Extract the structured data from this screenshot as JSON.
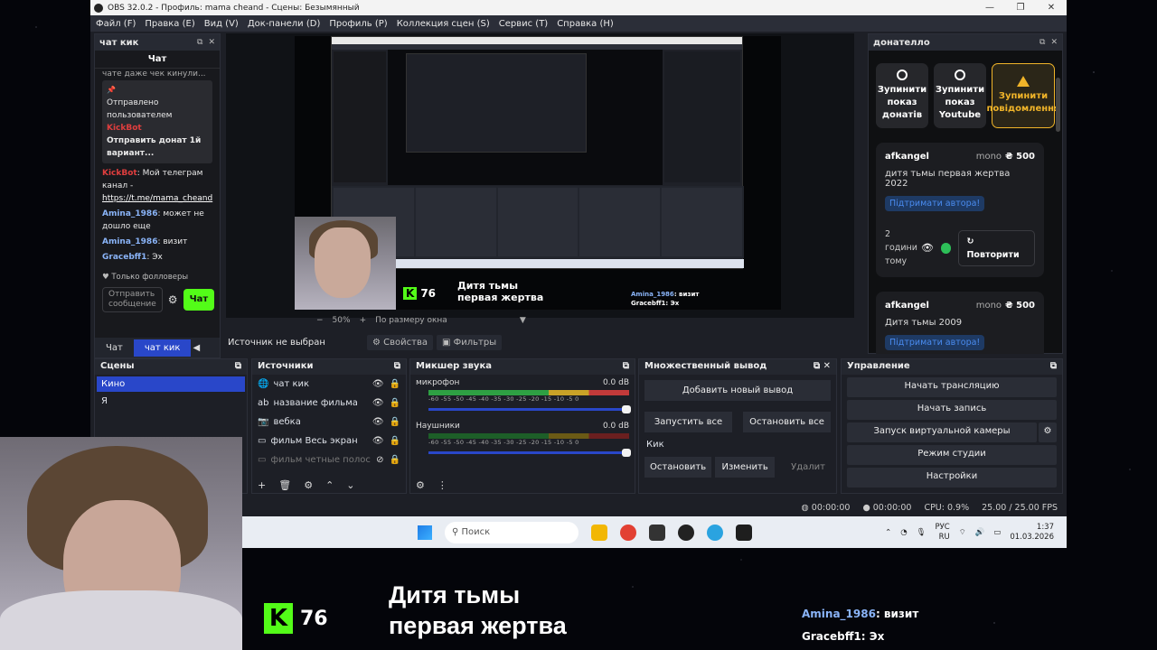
{
  "window": {
    "title": "OBS 32.0.2 - Профиль: mama cheand - Сцены: Безымянный",
    "menu": [
      "Файл (F)",
      "Правка (E)",
      "Вид (V)",
      "Док-панели (D)",
      "Профиль (P)",
      "Коллекция сцен (S)",
      "Сервис (T)",
      "Справка (H)"
    ]
  },
  "chat_dock": {
    "title": "чат кик",
    "subtitle": "Чат",
    "top_cut": "чате даже чек кинули...",
    "pinned_label": "Отправлено пользователем",
    "pinned_user": "KickBot",
    "pinned_text": "Отправить донат 1й вариант...",
    "msg1_user": "KickBot",
    "msg1_text": ": Мой телеграм канал - ",
    "msg1_link": "https://t.me/mama_cheand",
    "msg2_user": "Amina_1986",
    "msg2_text": ": может не дошло еще",
    "msg3_user": "Amina_1986",
    "msg3_text": ": визит",
    "msg4_user": "Gracebff1",
    "msg4_text": ": Эх",
    "followers_only": "Только фолловеры",
    "input_placeholder": "Отправить сообщение",
    "send_label": "Чат",
    "tab_chat": "Чат",
    "tab_kick": "чат кик"
  },
  "preview": {
    "overlay_count": "76",
    "overlay_film": "Дитя тьмы первая жертва",
    "chat_line1_user": "Amina_1986",
    "chat_line1_text": ": визит",
    "chat_line2_user": "Gracebff1",
    "chat_line2_text": ": Эх",
    "zoom": "50%",
    "fit": "По размеру окна"
  },
  "source_bar": {
    "label": "Источник не выбран",
    "properties": "Свойства",
    "filters": "Фильтры"
  },
  "donatello": {
    "title": "донателло",
    "btn1": "Зупинити показ донатів",
    "btn2": "Зупинити показ Youtube",
    "btn3": "Зупинити повідомлення",
    "card1": {
      "name": "afkangel",
      "method": "mono",
      "amount": "₴ 500",
      "message": "дитя тьмы первая жертва 2022",
      "support": "Підтримати автора!",
      "time": "2 години тому",
      "repeat": "Повторити"
    },
    "card2": {
      "name": "afkangel",
      "method": "mono",
      "amount": "₴ 500",
      "message": "Дитя тьмы 2009",
      "support": "Підтримати автора!"
    }
  },
  "scenes": {
    "title": "Сцены",
    "items": [
      "Кино",
      "Я"
    ]
  },
  "sources": {
    "title": "Источники",
    "items": [
      "чат кик",
      "название фильма",
      "вебка",
      "фильм Весь экран",
      "фильм четные полоск"
    ]
  },
  "mixer": {
    "title": "Микшер звука",
    "ch1": {
      "name": "микрофон",
      "db": "0.0 dB"
    },
    "ch2": {
      "name": "Наушники",
      "db": "0.0 dB"
    },
    "scale": "-60 -55 -50 -45 -40 -35 -30 -25 -20 -15 -10 -5 0"
  },
  "multi_output": {
    "title": "Множественный вывод",
    "add": "Добавить новый вывод",
    "start_all": "Запустить все",
    "stop_all": "Остановить все",
    "item_name": "Кик",
    "item_stop": "Остановить",
    "item_edit": "Изменить",
    "item_delete": "Удалит"
  },
  "control": {
    "title": "Управление",
    "start_stream": "Начать трансляцию",
    "start_record": "Начать запись",
    "virtual_cam": "Запуск виртуальной камеры",
    "studio_mode": "Режим студии",
    "settings": "Настройки"
  },
  "status": {
    "stream_time": "00:00:00",
    "rec_time": "00:00:00",
    "cpu": "CPU: 0.9%",
    "fps": "25.00 / 25.00 FPS"
  },
  "taskbar": {
    "search": "Поиск",
    "lang1": "РУС",
    "lang2": "RU",
    "time": "1:37",
    "date": "01.03.2026"
  },
  "overlay": {
    "kick_count": "76",
    "film_line1": "Дитя тьмы",
    "film_line2": "первая жертва",
    "chat1_user": "Amina_1986",
    "chat1_text": ": визит",
    "chat2_user": "Gracebff1",
    "chat2_text": ": Эх"
  }
}
